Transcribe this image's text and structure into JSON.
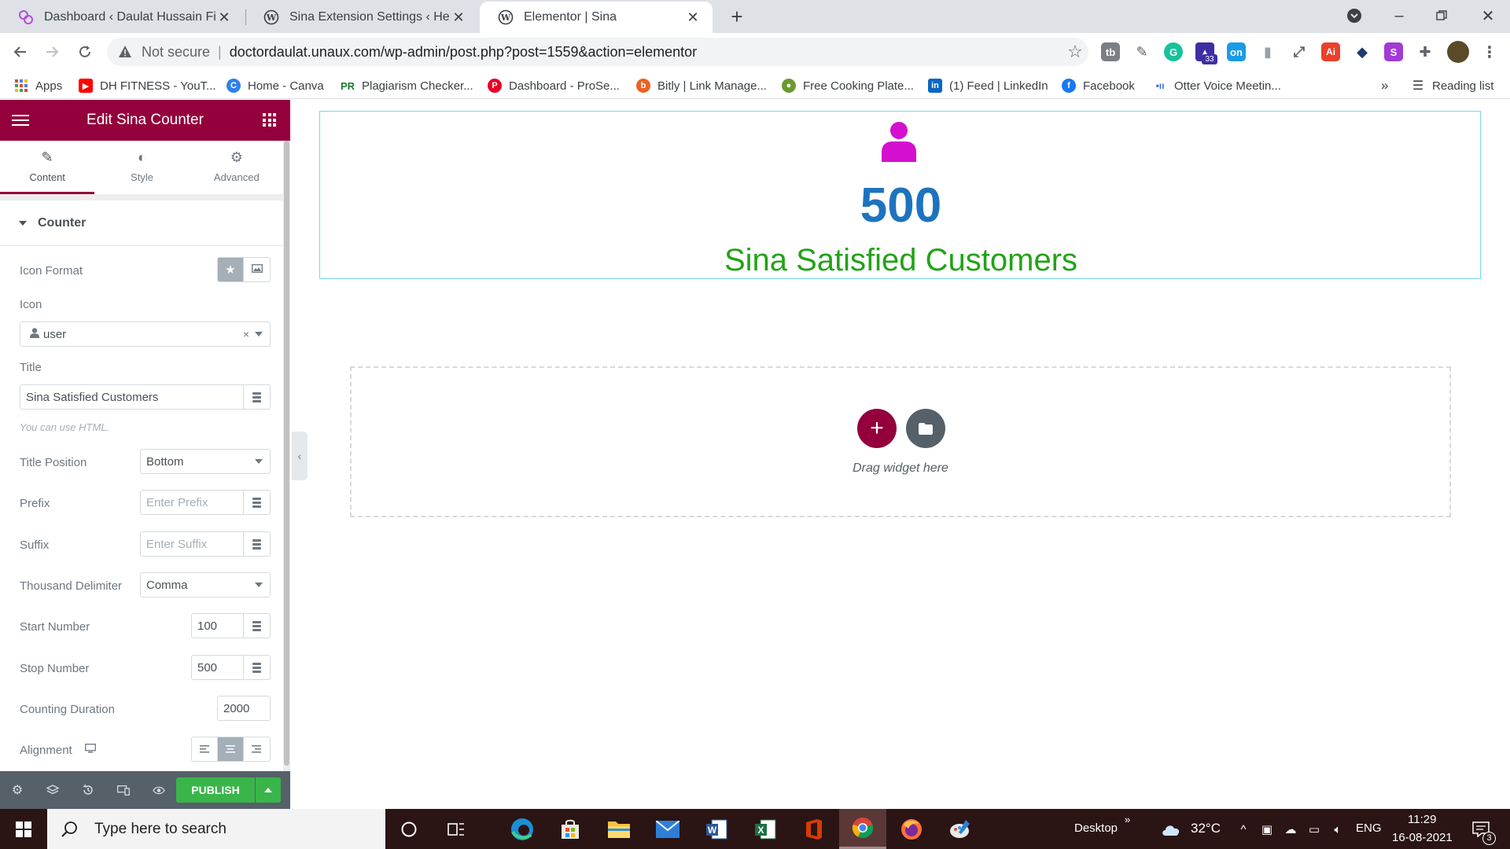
{
  "browser": {
    "tabs": [
      {
        "title": "Dashboard ‹ Daulat Hussain Fitness",
        "active": false
      },
      {
        "title": "Sina Extension Settings ‹ Health & Fitness",
        "active": false
      },
      {
        "title": "Elementor | Sina",
        "active": true
      }
    ],
    "not_secure": "Not secure",
    "url": "doctordaulat.unaux.com/wp-admin/post.php?post=1559&action=elementor",
    "extension_badge": "33",
    "bookmarks": [
      {
        "label": "Apps",
        "icon": "apps-grid-icon"
      },
      {
        "label": "DH FITNESS - YouT...",
        "icon": "youtube-icon",
        "color": "#ff0000"
      },
      {
        "label": "Home - Canva",
        "icon": "canva-icon",
        "color": "#2f80ed"
      },
      {
        "label": "Plagiarism Checker...",
        "icon": "pr-icon",
        "color": "#1f7a32"
      },
      {
        "label": "Dashboard - ProSe...",
        "icon": "pinterest-icon",
        "color": "#e60023"
      },
      {
        "label": "Bitly | Link Manage...",
        "icon": "bitly-icon",
        "color": "#ee6123"
      },
      {
        "label": "Free Cooking Plate...",
        "icon": "plate-icon",
        "color": "#6a9a2e"
      },
      {
        "label": "(1) Feed | LinkedIn",
        "icon": "linkedin-icon",
        "color": "#0a66c2"
      },
      {
        "label": "Facebook",
        "icon": "facebook-icon",
        "color": "#1877f2"
      },
      {
        "label": "Otter Voice Meetin...",
        "icon": "otter-icon",
        "color": "#3a6ee8"
      }
    ],
    "bookmarks_more": "»",
    "reading_list": "Reading list"
  },
  "panel": {
    "title": "Edit Sina Counter",
    "tabs": [
      {
        "label": "Content",
        "icon": "pencil-icon",
        "active": true
      },
      {
        "label": "Style",
        "icon": "half-circle-icon",
        "active": false
      },
      {
        "label": "Advanced",
        "icon": "gear-icon",
        "active": false
      }
    ],
    "section": "Counter",
    "controls": {
      "icon_format": "Icon Format",
      "icon_label": "Icon",
      "icon_value": "user",
      "title_label": "Title",
      "title_value": "Sina Satisfied Customers",
      "title_hint": "You can use HTML.",
      "title_position_label": "Title Position",
      "title_position_value": "Bottom",
      "prefix_label": "Prefix",
      "prefix_placeholder": "Enter Prefix",
      "suffix_label": "Suffix",
      "suffix_placeholder": "Enter Suffix",
      "thousand_label": "Thousand Delimiter",
      "thousand_value": "Comma",
      "start_label": "Start Number",
      "start_value": "100",
      "stop_label": "Stop Number",
      "stop_value": "500",
      "duration_label": "Counting Duration",
      "duration_value": "2000",
      "alignment_label": "Alignment"
    },
    "publish": "PUBLISH"
  },
  "preview": {
    "counter_number": "500",
    "counter_title": "Sina Satisfied Customers",
    "counter_icon_color": "#d40fcf",
    "number_color": "#1e73be",
    "title_color": "#22a317",
    "drag_text": "Drag widget here"
  },
  "taskbar": {
    "search_placeholder": "Type here to search",
    "desktop": "Desktop",
    "weather": "32°C",
    "lang": "ENG",
    "time": "11:29",
    "date": "16-08-2021",
    "notifications": "3"
  },
  "colors": {
    "elementor_accent": "#93003c",
    "publish_green": "#39b54a",
    "widget_border": "#71d7f7"
  }
}
